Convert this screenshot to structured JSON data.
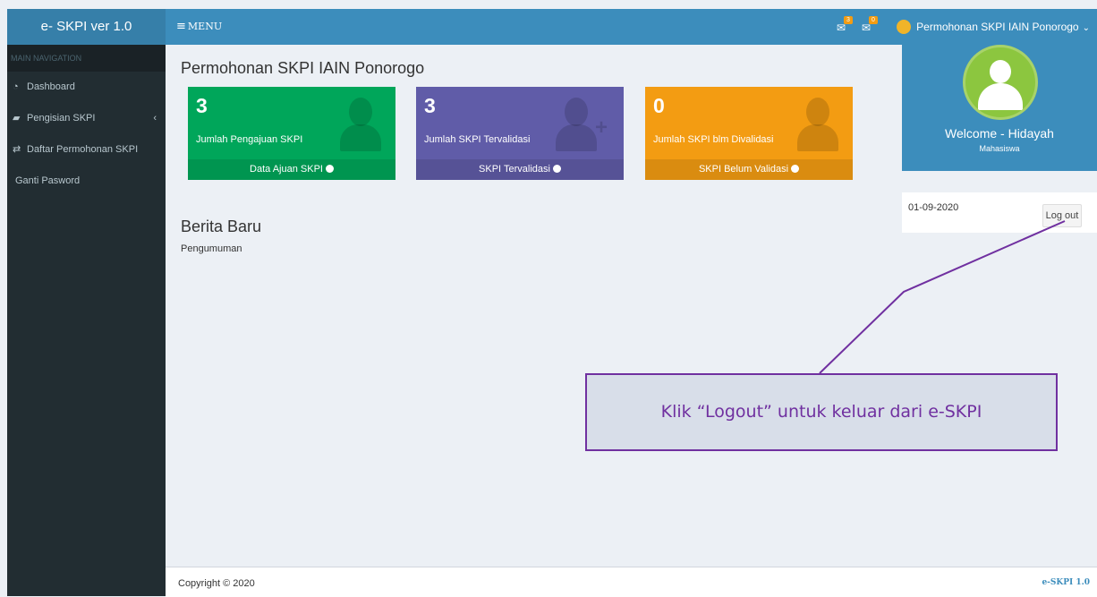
{
  "app": {
    "logo": "e- SKPI ver 1.0"
  },
  "topbar": {
    "menu_label": "MENU",
    "menu_icon": "hamburger-icon",
    "notifications": [
      {
        "icon": "envelope-icon",
        "badge": "3"
      },
      {
        "icon": "envelope-icon",
        "badge": "0"
      }
    ],
    "user_label": "Permohonan SKPI IAIN Ponorogo"
  },
  "sidebar": {
    "header": "MAIN NAVIGATION",
    "items": [
      {
        "label": "Dashboard",
        "icon": "dashboard-icon"
      },
      {
        "label": "Pengisian SKPI",
        "icon": "book-icon",
        "chevron": "‹"
      },
      {
        "label": "Daftar Permohonan SKPI",
        "icon": "exchange-icon"
      },
      {
        "label": "Ganti Pasword",
        "icon": ""
      }
    ]
  },
  "main": {
    "title": "Permohonan SKPI IAIN Ponorogo",
    "boxes": [
      {
        "number": "3",
        "text": "Jumlah Pengajuan SKPI",
        "footer": "Data Ajuan SKPI",
        "color": "#00a65a",
        "icon": "user-icon"
      },
      {
        "number": "3",
        "text": "Jumlah SKPI Tervalidasi",
        "footer": "SKPI Tervalidasi",
        "color": "#605ca8",
        "icon": "user-plus-icon"
      },
      {
        "number": "0",
        "text": "Jumlah SKPI blm Divalidasi",
        "footer": "SKPI Belum Validasi",
        "color": "#f39c12",
        "icon": "user-icon"
      }
    ],
    "section_title": "Berita Baru",
    "section_sub": "Pengumuman"
  },
  "profile": {
    "welcome": "Welcome - Hidayah",
    "role": "Mahasiswa",
    "date": "01-09-2020",
    "logout_label": "Log out"
  },
  "annotation": {
    "text": "Klik “Logout” untuk keluar dari e-SKPI",
    "color": "#7030a0"
  },
  "footer": {
    "copyright": "Copyright © 2020",
    "brand": "e-SKPI 1.0"
  }
}
